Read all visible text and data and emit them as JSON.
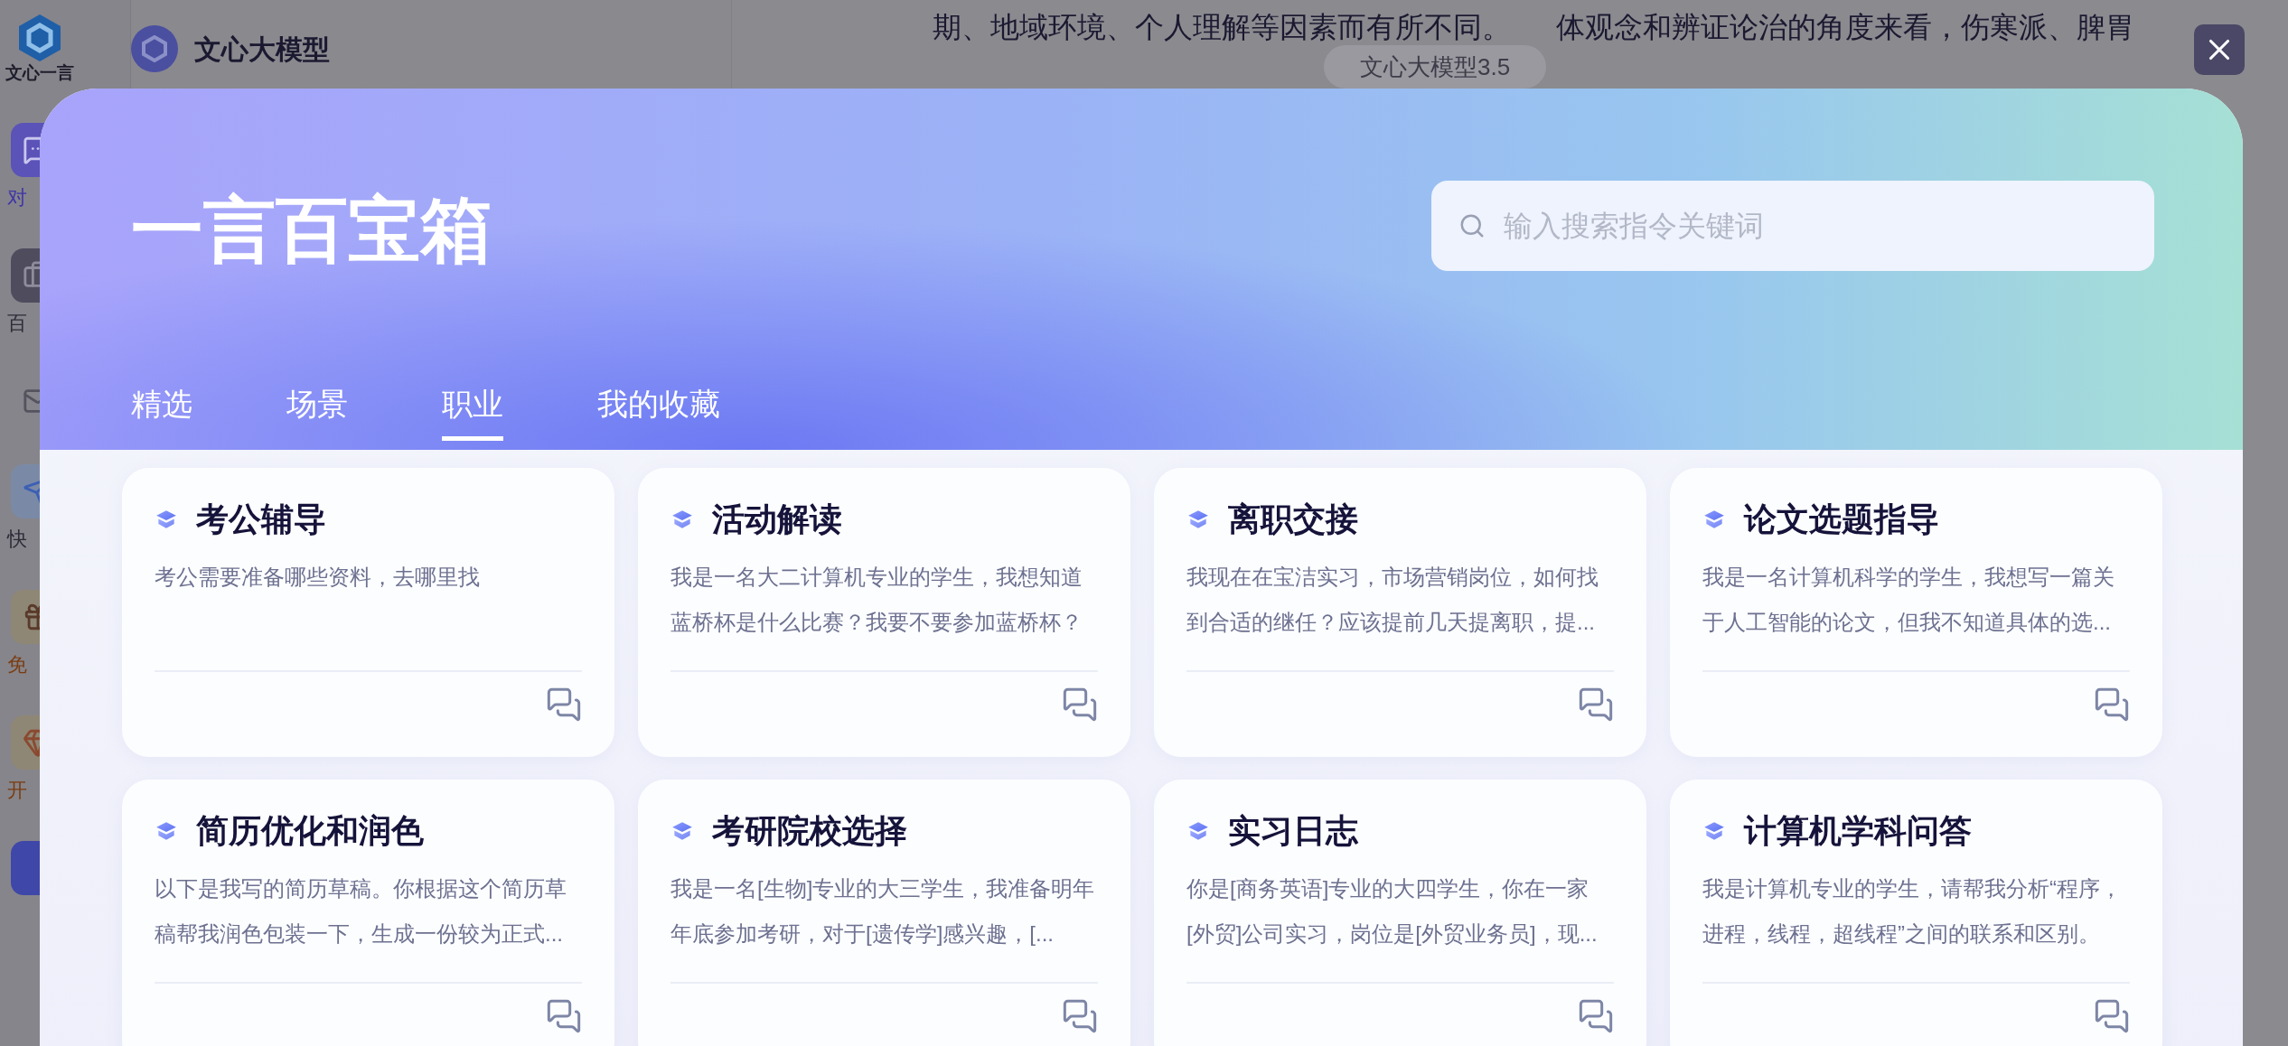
{
  "app_sidebar": {
    "logo_label": "文心一言",
    "items": [
      {
        "kind": "chat",
        "label": "对"
      },
      {
        "kind": "toolbox",
        "label": "百"
      },
      {
        "kind": "mail"
      },
      {
        "kind": "send",
        "label": "快"
      },
      {
        "kind": "gift",
        "label": "免"
      },
      {
        "kind": "vip",
        "label": "开"
      },
      {
        "kind": "avatar"
      }
    ]
  },
  "model_panel": {
    "title": "文心大模型"
  },
  "conversation": {
    "segments": [
      "期、地域环境、个人理解等因素而有所不同。",
      "体观念和辨证论治的角度来看，伤寒派、脾胃"
    ]
  },
  "model_tooltip": "文心大模型3.5",
  "dialog": {
    "title": "一言百宝箱",
    "search": {
      "placeholder": "输入搜索指令关键词"
    },
    "tabs": [
      {
        "label": "精选",
        "selected": false
      },
      {
        "label": "场景",
        "selected": false
      },
      {
        "label": "职业",
        "selected": true
      },
      {
        "label": "我的收藏",
        "selected": false
      }
    ],
    "cards": [
      {
        "title": "考公辅导",
        "description": "考公需要准备哪些资料，去哪里找"
      },
      {
        "title": "活动解读",
        "description": "我是一名大二计算机专业的学生，我想知道蓝桥杯是什么比赛？我要不要参加蓝桥杯？"
      },
      {
        "title": "离职交接",
        "description": "我现在在宝洁实习，市场营销岗位，如何找到合适的继任？应该提前几天提离职，提..."
      },
      {
        "title": "论文选题指导",
        "description": "我是一名计算机科学的学生，我想写一篇关于人工智能的论文，但我不知道具体的选..."
      },
      {
        "title": "简历优化和润色",
        "description": "以下是我写的简历草稿。你根据这个简历草稿帮我润色包装一下，生成一份较为正式..."
      },
      {
        "title": "考研院校选择",
        "description": "我是一名[生物]专业的大三学生，我准备明年年底参加考研，对于[遗传学]感兴趣，[..."
      },
      {
        "title": "实习日志",
        "description": "你是[商务英语]专业的大四学生，你在一家[外贸]公司实习，岗位是[外贸业务员]，现..."
      },
      {
        "title": "计算机学科问答",
        "description": "我是计算机专业的学生，请帮我分析“程序，进程，线程，超线程”之间的联系和区别。"
      }
    ]
  }
}
